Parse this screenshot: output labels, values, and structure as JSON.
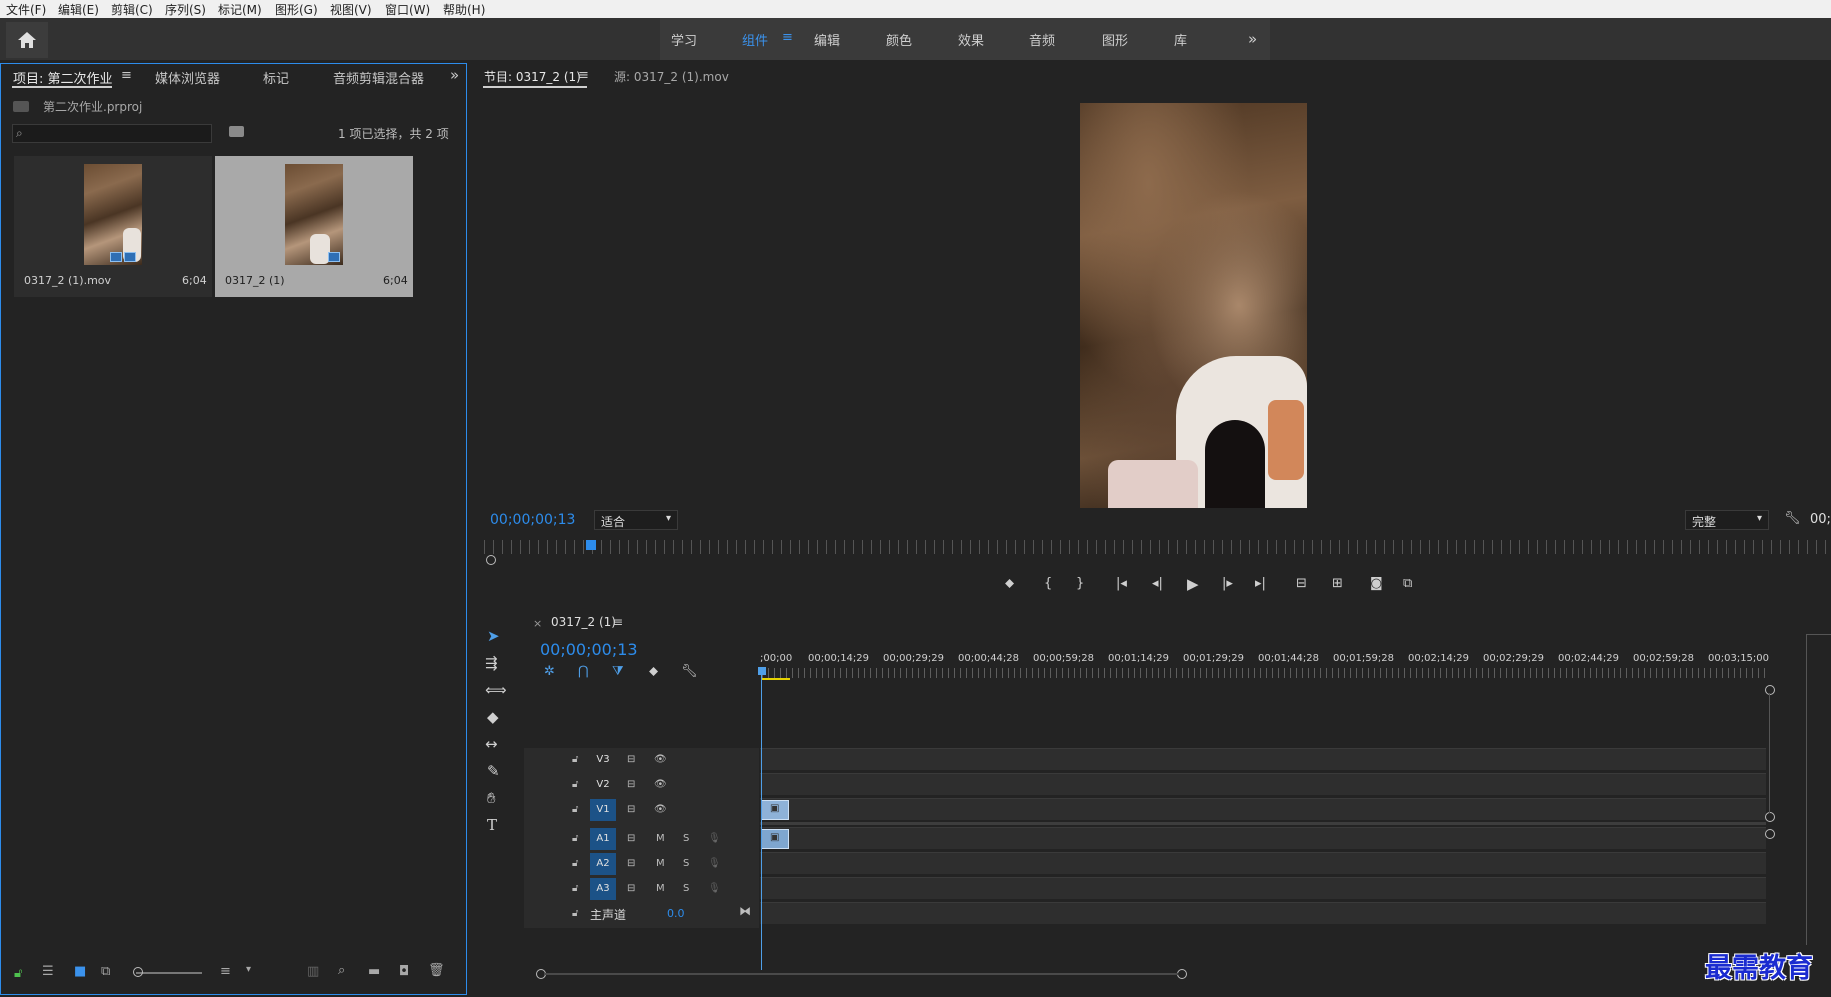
{
  "menu": [
    "文件(F)",
    "编辑(E)",
    "剪辑(C)",
    "序列(S)",
    "标记(M)",
    "图形(G)",
    "视图(V)",
    "窗口(W)",
    "帮助(H)"
  ],
  "workspaces": [
    "学习",
    "组件",
    "编辑",
    "颜色",
    "效果",
    "音频",
    "图形",
    "库"
  ],
  "workspace_active": "组件",
  "project_panel": {
    "tabs": [
      "项目: 第二次作业",
      "媒体浏览器",
      "标记",
      "音频剪辑混合器"
    ],
    "project_file": "第二次作业.prproj",
    "selection_status": "1 项已选择，共 2 项",
    "clips": [
      {
        "name": "0317_2 (1).mov",
        "duration": "6;04"
      },
      {
        "name": "0317_2 (1)",
        "duration": "6;04"
      }
    ]
  },
  "program_monitor": {
    "tab_program": "节目: 0317_2 (1)",
    "tab_source": "源: 0317_2 (1).mov",
    "timecode": "00;00;00;13",
    "zoom": "适合",
    "quality": "完整",
    "timecode_right": "00;"
  },
  "timeline": {
    "sequence_tab": "0317_2 (1)",
    "timecode": "00;00;00;13",
    "ruler_ticks": [
      ";00;00",
      "00;00;14;29",
      "00;00;29;29",
      "00;00;44;28",
      "00;00;59;28",
      "00;01;14;29",
      "00;01;29;29",
      "00;01;44;28",
      "00;01;59;28",
      "00;02;14;29",
      "00;02;29;29",
      "00;02;44;29",
      "00;02;59;28",
      "00;03;15;00"
    ],
    "video_tracks": [
      "V3",
      "V2",
      "V1"
    ],
    "audio_tracks": [
      "A1",
      "A2",
      "A3"
    ],
    "master_label": "主声道",
    "master_value": "0.0",
    "mute_label": "M",
    "solo_label": "S"
  },
  "watermark": "最需教育",
  "colors": {
    "accent": "#2d8ceb",
    "track_on": "#1c5287",
    "clip": "#8eb2d8"
  }
}
